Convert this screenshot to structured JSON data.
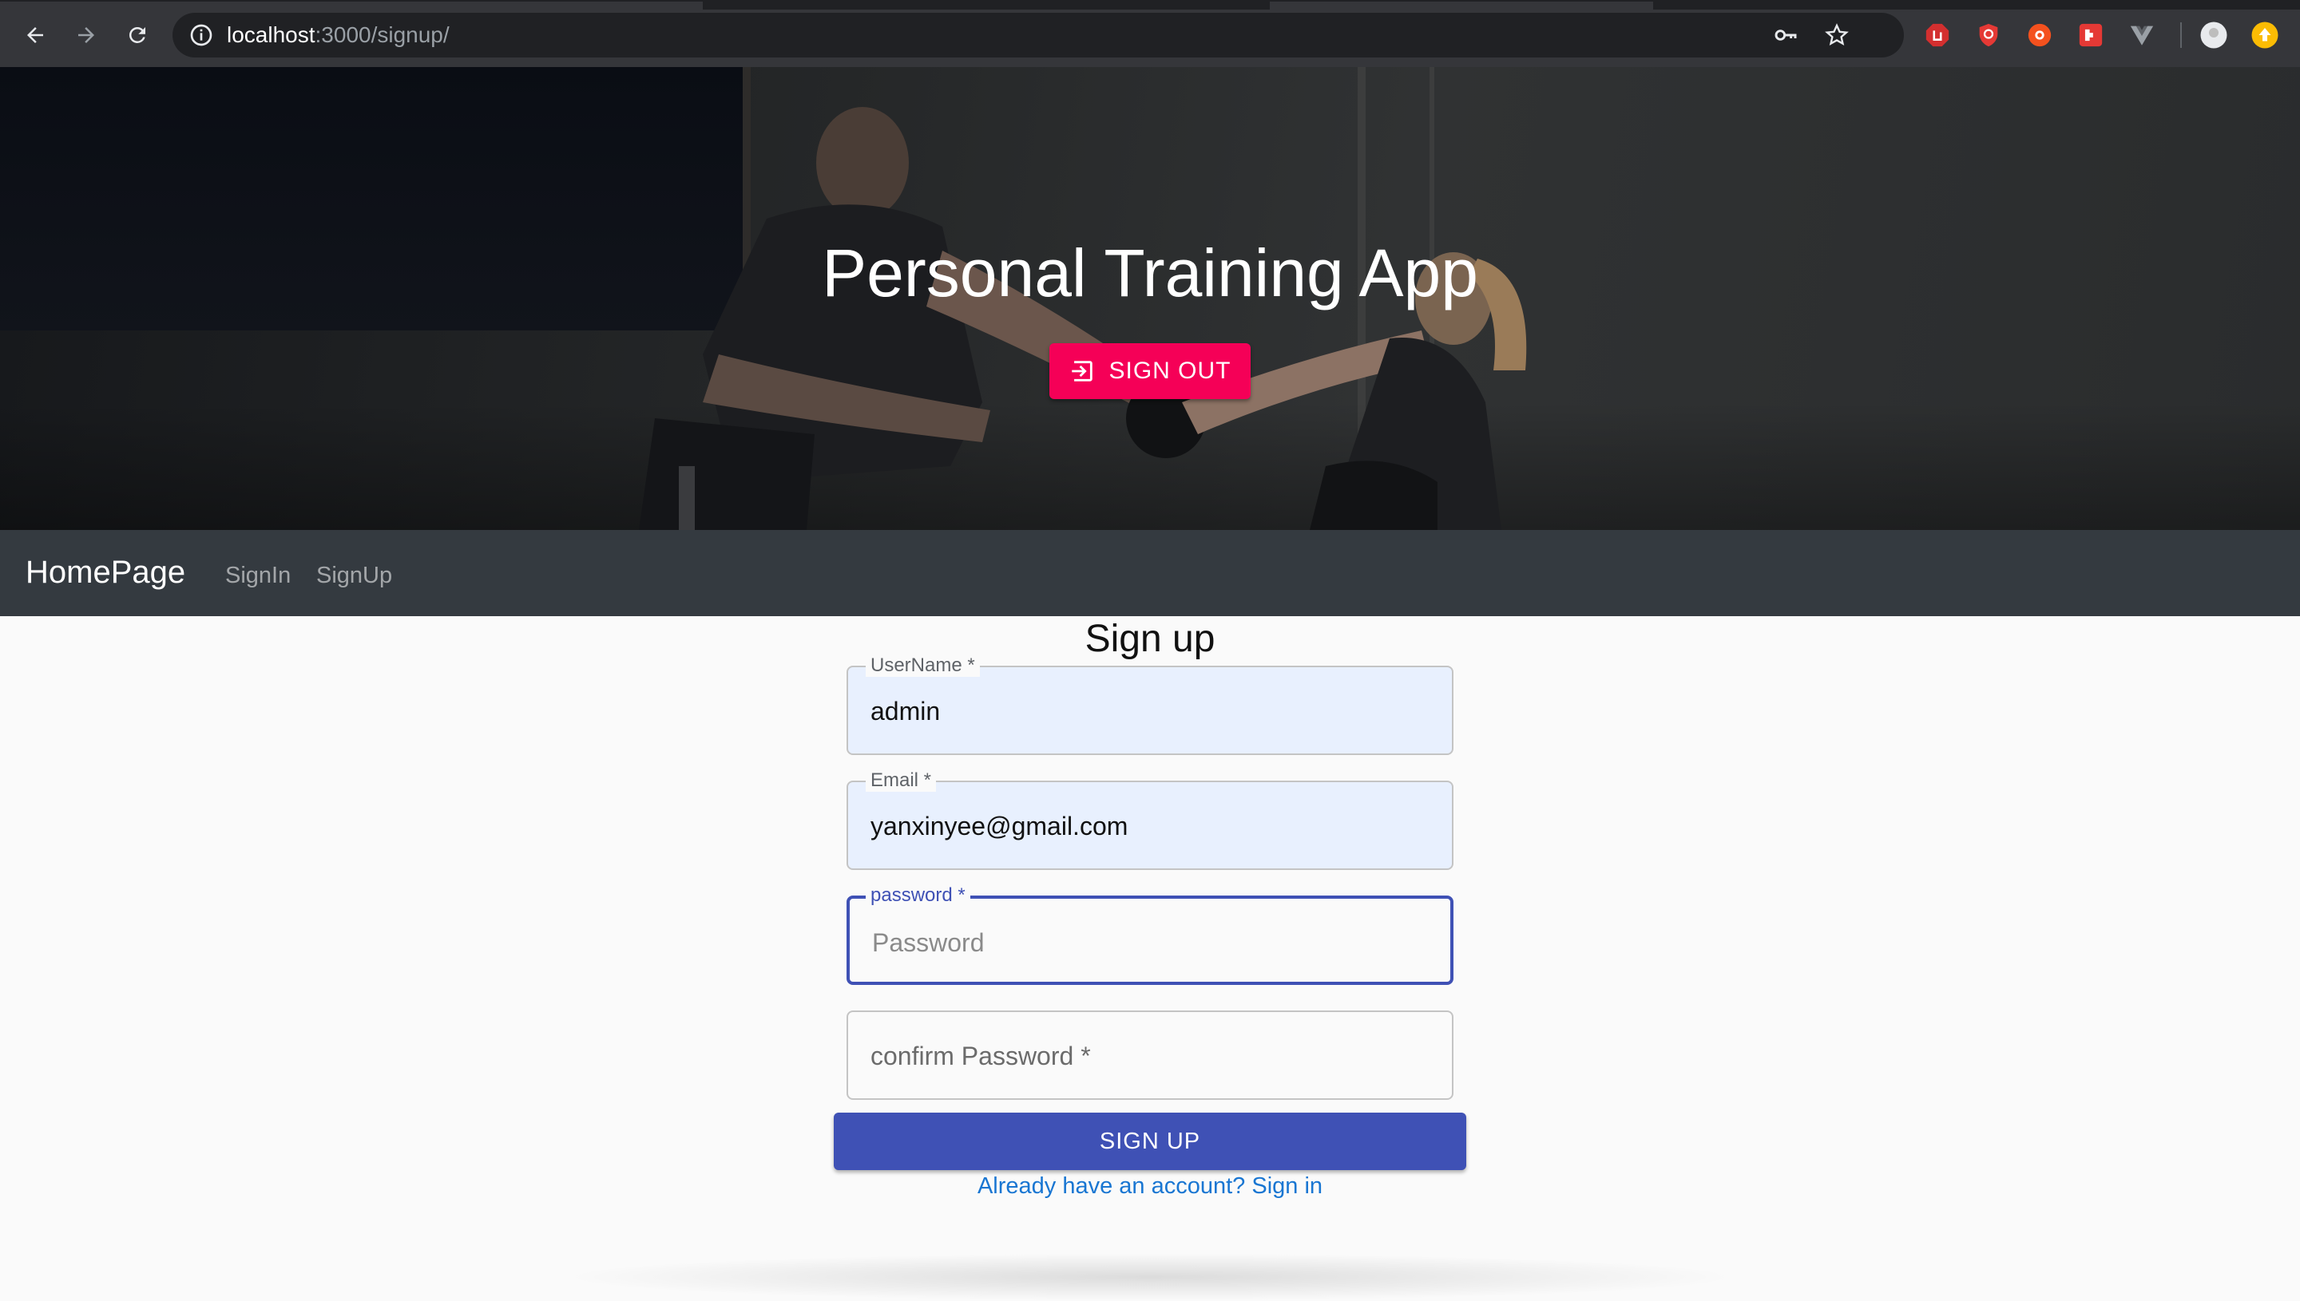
{
  "browser": {
    "url_host": "localhost",
    "url_path": ":3000/signup/"
  },
  "hero": {
    "title": "Personal Training App",
    "signout_label": "SIGN OUT"
  },
  "nav": {
    "brand": "HomePage",
    "links": [
      "SignIn",
      "SignUp"
    ]
  },
  "form": {
    "title": "Sign up",
    "username_label": "UserName *",
    "username_value": "admin",
    "email_label": "Email *",
    "email_value": "yanxinyee@gmail.com",
    "password_label": "password *",
    "password_placeholder": "Password",
    "confirm_placeholder": "confirm Password *",
    "submit_label": "SIGN UP",
    "signin_link": "Already have an account? Sign in"
  },
  "colors": {
    "accent_pink": "#f50057",
    "primary_indigo": "#3f51b5",
    "link_blue": "#1976d2",
    "navbar": "#343a40"
  }
}
